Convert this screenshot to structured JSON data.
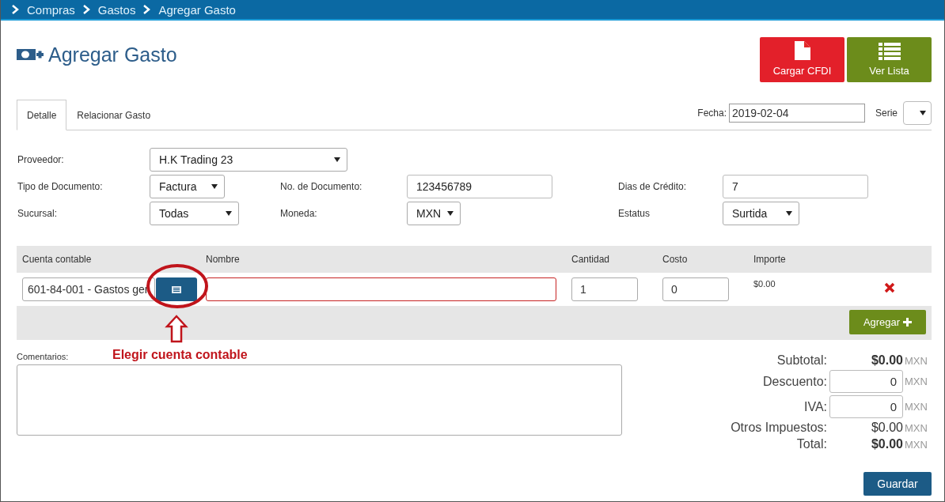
{
  "breadcrumb": [
    "Compras",
    "Gastos",
    "Agregar Gasto"
  ],
  "page_title": "Agregar Gasto",
  "header_buttons": [
    {
      "kind": "file",
      "label": "Cargar CFDI"
    },
    {
      "kind": "list",
      "label": "Ver Lista"
    }
  ],
  "tabs": [
    {
      "label": "Detalle",
      "selected": true
    },
    {
      "label": "Relacionar Gasto",
      "selected": false
    }
  ],
  "fecha": {
    "label": "Fecha:",
    "value": "2019-02-04"
  },
  "serie": {
    "label": "Serie"
  },
  "form_rows": [
    [
      {
        "label": "Proveedor:",
        "kind": "select",
        "value": "H.K Trading 23"
      }
    ],
    [
      {
        "label": "Tipo de Documento:",
        "kind": "select",
        "value": "Factura"
      },
      {
        "label": "No. de Documento:",
        "kind": "input",
        "value": "123456789"
      },
      {
        "label": "Dias de Crédito:",
        "kind": "input",
        "value": "7"
      }
    ],
    [
      {
        "label": "Sucursal:",
        "kind": "select",
        "value": "Todas"
      },
      {
        "label": "Moneda:",
        "kind": "select",
        "value": "MXN"
      },
      {
        "label": "Estatus",
        "kind": "select",
        "value": "Surtida"
      }
    ]
  ],
  "items_table": {
    "columns": [
      "Cuenta contable",
      "Nombre",
      "Cantidad",
      "Costo",
      "Importe"
    ],
    "rows": [
      {
        "cuenta": "601-84-001 - Gastos ger",
        "nombre_error": true,
        "cantidad": "1",
        "costo": "0",
        "importe": "$0.00"
      }
    ],
    "add_button": "Agregar"
  },
  "annotation": "Elegir cuenta contable",
  "comments": {
    "label": "Comentarios:"
  },
  "totals": [
    {
      "label": "Subtotal:",
      "kind": "amount",
      "value": "$0.00",
      "currency": "MXN"
    },
    {
      "label": "Descuento:",
      "kind": "input",
      "value": "0",
      "currency": "MXN"
    },
    {
      "label": "IVA:",
      "kind": "input",
      "value": "0",
      "currency": "MXN"
    },
    {
      "label": "Otros Impuestos:",
      "kind": "plain",
      "value": "$0.00",
      "currency": "MXN"
    },
    {
      "label": "Total:",
      "kind": "amount",
      "value": "$0.00",
      "currency": "MXN"
    }
  ],
  "save_button": "Guardar"
}
